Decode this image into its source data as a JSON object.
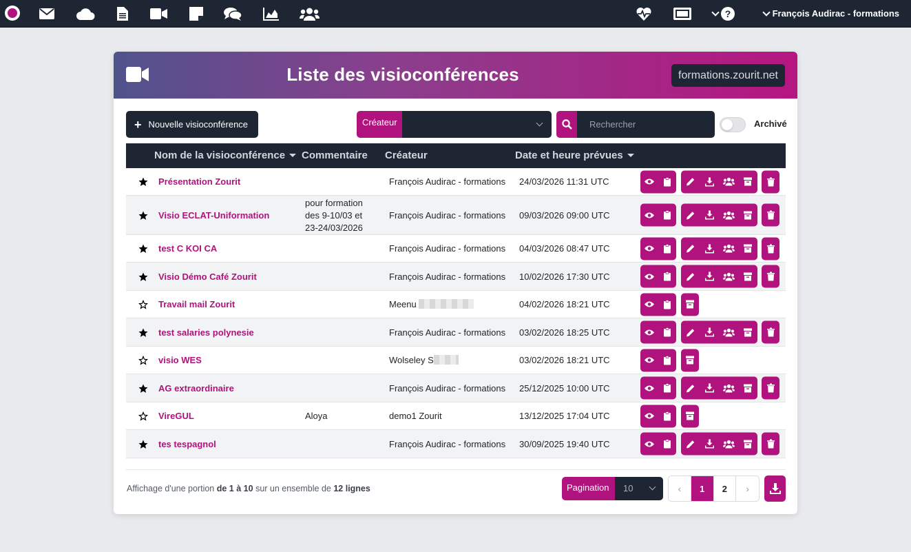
{
  "topbar": {
    "icons": [
      "octopus-logo",
      "mail-icon",
      "cloud-icon",
      "document-icon",
      "video-icon",
      "note-icon",
      "chat-icon",
      "chart-icon",
      "users-icon",
      "heartbeat-icon",
      "screen-icon",
      "help-icon"
    ],
    "user_name": "François Audirac - formations"
  },
  "header": {
    "title": "Liste des visioconférences",
    "domain": "formations.zourit.net"
  },
  "toolbar": {
    "new_label": "Nouvelle visioconférence",
    "creator_filter_label": "Créateur",
    "search_placeholder": "Rechercher",
    "archived_label": "Archivé",
    "archived_on": false
  },
  "table": {
    "columns": {
      "name": "Nom de la visioconférence",
      "comment": "Commentaire",
      "creator": "Créateur",
      "date": "Date et heure prévues"
    },
    "rows": [
      {
        "starred": true,
        "name": "Présentation Zourit",
        "comment": "",
        "creator": "François Audirac - formations",
        "date": "24/03/2026 11:31 UTC",
        "owner": true
      },
      {
        "starred": true,
        "name": "Visio ECLAT-Uniformation",
        "comment": "pour formation des 9-10/03 et 23-24/03/2026",
        "creator": "François Audirac - formations",
        "date": "09/03/2026 09:00 UTC",
        "owner": true
      },
      {
        "starred": true,
        "name": "test C KOI CA",
        "comment": "",
        "creator": "François Audirac - formations",
        "date": "04/03/2026 08:47 UTC",
        "owner": true
      },
      {
        "starred": true,
        "name": "Visio Démo Café Zourit",
        "comment": "",
        "creator": "François Audirac - formations",
        "date": "10/02/2026 17:30 UTC",
        "owner": true
      },
      {
        "starred": false,
        "name": "Travail mail Zourit",
        "comment": "",
        "creator": "Meenu",
        "date": "04/02/2026 18:21 UTC",
        "owner": false
      },
      {
        "starred": true,
        "name": "test salaries polynesie",
        "comment": "",
        "creator": "François Audirac - formations",
        "date": "03/02/2026 18:25 UTC",
        "owner": true
      },
      {
        "starred": false,
        "name": "visio WES",
        "comment": "",
        "creator": "Wolseley S",
        "date": "03/02/2026 18:21 UTC",
        "owner": false
      },
      {
        "starred": true,
        "name": "AG extraordinaire",
        "comment": "",
        "creator": "François Audirac - formations",
        "date": "25/12/2025 10:00 UTC",
        "owner": true
      },
      {
        "starred": false,
        "name": "VireGUL",
        "comment": "Aloya",
        "creator": "demo1 Zourit",
        "date": "13/12/2025 17:04 UTC",
        "owner": false
      },
      {
        "starred": true,
        "name": "tes tespagnol",
        "comment": "",
        "creator": "François Audirac - formations",
        "date": "30/09/2025 19:40 UTC",
        "owner": true
      }
    ]
  },
  "footer": {
    "info_prefix": "Affichage d'une portion",
    "info_range": "de 1 à 10",
    "info_middle": "sur un ensemble de",
    "info_total": "12 lignes",
    "pagination_label": "Pagination",
    "page_size": "10",
    "pages": [
      "1",
      "2"
    ],
    "current_page": "1"
  },
  "colors": {
    "accent": "#b0127e",
    "dark": "#1f2633",
    "background": "#e9eaed"
  }
}
